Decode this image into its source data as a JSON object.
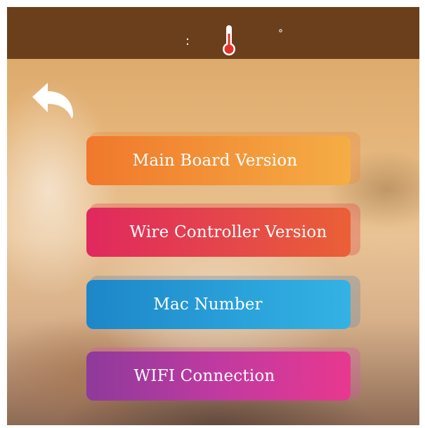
{
  "statusbar": {
    "separator": ":",
    "thermometer_icon": "thermometer-icon",
    "degree_symbol": "°"
  },
  "back_icon": "back-arrow-icon",
  "menu": {
    "items": [
      {
        "label": "Main Board Version",
        "color": "#f3983a"
      },
      {
        "label": "Wire Controller Version",
        "color": "#e54a48"
      },
      {
        "label": "Mac Number",
        "color": "#2aa2da"
      },
      {
        "label": "WIFI Connection",
        "color": "#c03aa0"
      }
    ]
  },
  "colors": {
    "topbar": "#6b3f1b"
  }
}
